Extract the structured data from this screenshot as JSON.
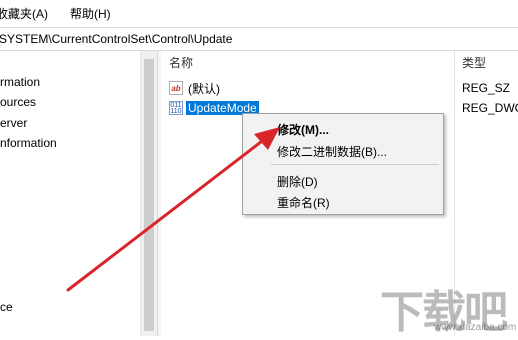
{
  "menubar": {
    "items": [
      "收藏夹(A)",
      "帮助(H)"
    ]
  },
  "address": {
    "path": "SYSTEM\\CurrentControlSet\\Control\\Update"
  },
  "tree": {
    "items": [
      "rmation",
      "ources",
      "erver",
      "nformation",
      "ce"
    ]
  },
  "values_pane": {
    "col_name": "名称",
    "col_type": "类型",
    "rows": [
      {
        "name": "(默认)",
        "type": "REG_SZ",
        "icon": "string-value-icon"
      },
      {
        "name": "UpdateMode",
        "type": "REG_DWC",
        "icon": "dword-value-icon"
      }
    ]
  },
  "context_menu": {
    "modify": "修改(M)...",
    "modify_binary": "修改二进制数据(B)...",
    "delete": "删除(D)",
    "rename": "重命名(R)"
  },
  "icons": {
    "string_icon_glyph": "ab",
    "dword_icon_glyph": "011\n110"
  },
  "colors": {
    "selection": "#0078d7",
    "arrow": "#d9252a"
  },
  "watermark": {
    "main": "下载吧",
    "sub": "www.xiazaiba.com"
  }
}
